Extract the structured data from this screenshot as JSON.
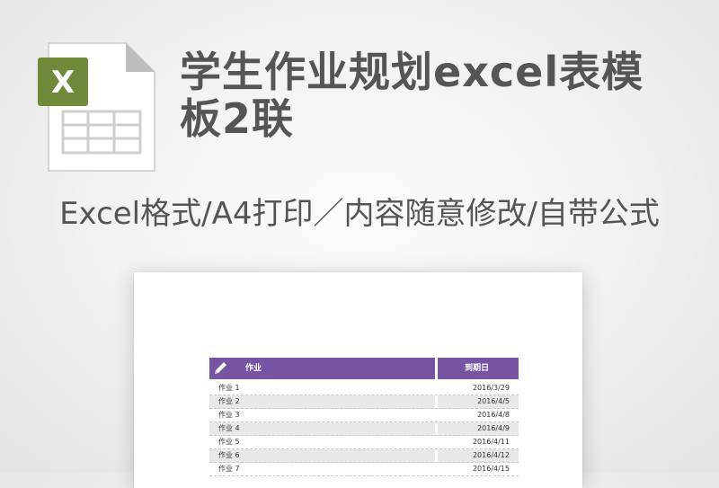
{
  "header": {
    "title": "学生作业规划excel表模板2联",
    "subtitle": "Excel格式/A4打印／内容随意修改/自带公式"
  },
  "file_icon": {
    "name": "excel-file-icon",
    "letter": "X",
    "accent_color": "#6f8a3a"
  },
  "sheet": {
    "header_color": "#7654a3",
    "columns": [
      "作业",
      "到期日"
    ],
    "rows": [
      {
        "task": "作业 1",
        "date": "2016/3/29"
      },
      {
        "task": "作业 2",
        "date": "2016/4/5"
      },
      {
        "task": "作业 3",
        "date": "2016/4/8"
      },
      {
        "task": "作业 4",
        "date": "2016/4/9"
      },
      {
        "task": "作业 5",
        "date": "2016/4/11"
      },
      {
        "task": "作业 6",
        "date": "2016/4/12"
      },
      {
        "task": "作业 7",
        "date": "2016/4/15"
      }
    ]
  }
}
